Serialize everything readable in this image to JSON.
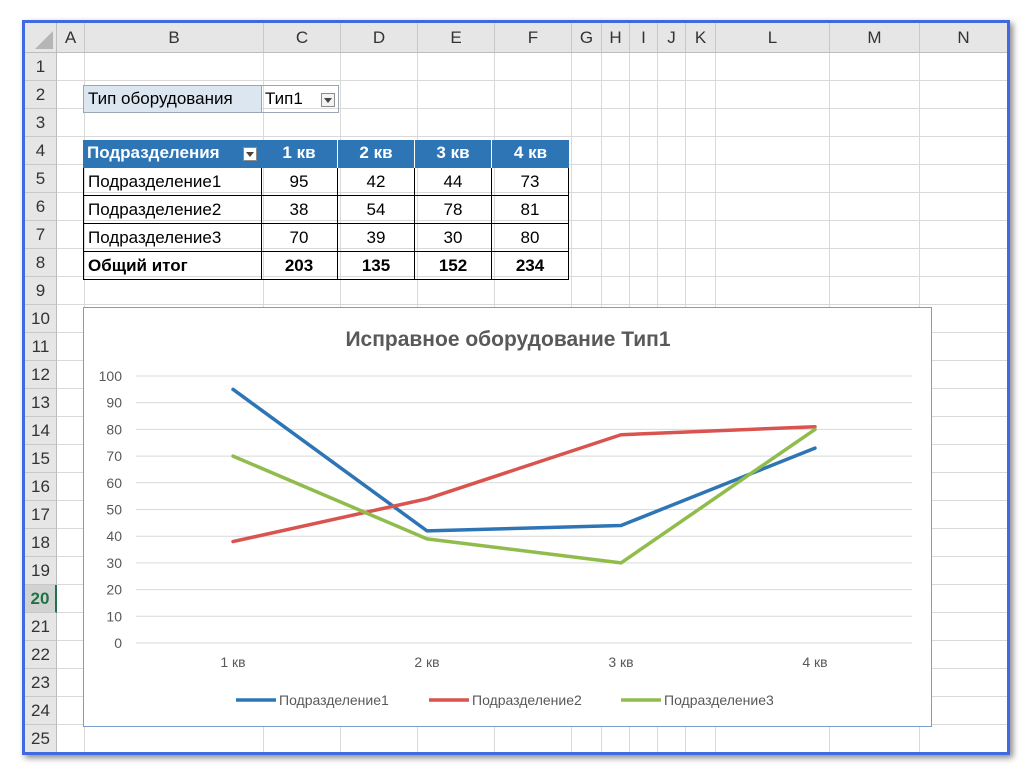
{
  "column_headers": [
    "A",
    "B",
    "C",
    "D",
    "E",
    "F",
    "G",
    "H",
    "I",
    "J",
    "K",
    "L",
    "M",
    "N"
  ],
  "row_headers": [
    "1",
    "2",
    "3",
    "4",
    "5",
    "6",
    "7",
    "8",
    "9",
    "10",
    "11",
    "12",
    "13",
    "14",
    "15",
    "16",
    "17",
    "18",
    "19",
    "20",
    "21",
    "22",
    "23",
    "24",
    "25"
  ],
  "selected_row": "20",
  "filter": {
    "label": "Тип оборудования",
    "value": "Тип1"
  },
  "pivot": {
    "headers": [
      "Подразделения",
      "1 кв",
      "2 кв",
      "3 кв",
      "4 кв"
    ],
    "rows": [
      {
        "name": "Подразделение1",
        "values": [
          "95",
          "42",
          "44",
          "73"
        ]
      },
      {
        "name": "Подразделение2",
        "values": [
          "38",
          "54",
          "78",
          "81"
        ]
      },
      {
        "name": "Подразделение3",
        "values": [
          "70",
          "39",
          "30",
          "80"
        ]
      }
    ],
    "total": {
      "name": "Общий итог",
      "values": [
        "203",
        "135",
        "152",
        "234"
      ]
    }
  },
  "chart_data": {
    "type": "line",
    "title": "Исправное оборудование Тип1",
    "categories": [
      "1 кв",
      "2 кв",
      "3 кв",
      "4 кв"
    ],
    "ylim": [
      0,
      100
    ],
    "yticks": [
      0,
      10,
      20,
      30,
      40,
      50,
      60,
      70,
      80,
      90,
      100
    ],
    "grid": true,
    "legend": "bottom",
    "series": [
      {
        "name": "Подразделение1",
        "values": [
          95,
          42,
          44,
          73
        ],
        "color": "#2e75b6"
      },
      {
        "name": "Подразделение2",
        "values": [
          38,
          54,
          78,
          81
        ],
        "color": "#d9534f"
      },
      {
        "name": "Подразделение3",
        "values": [
          70,
          39,
          30,
          80
        ],
        "color": "#8fbc4b"
      }
    ]
  },
  "colors": {
    "header_fill": "#2e75b6",
    "filter_fill": "#dce6f1",
    "frame": "#4169e1",
    "selected_row_text": "#217346"
  }
}
